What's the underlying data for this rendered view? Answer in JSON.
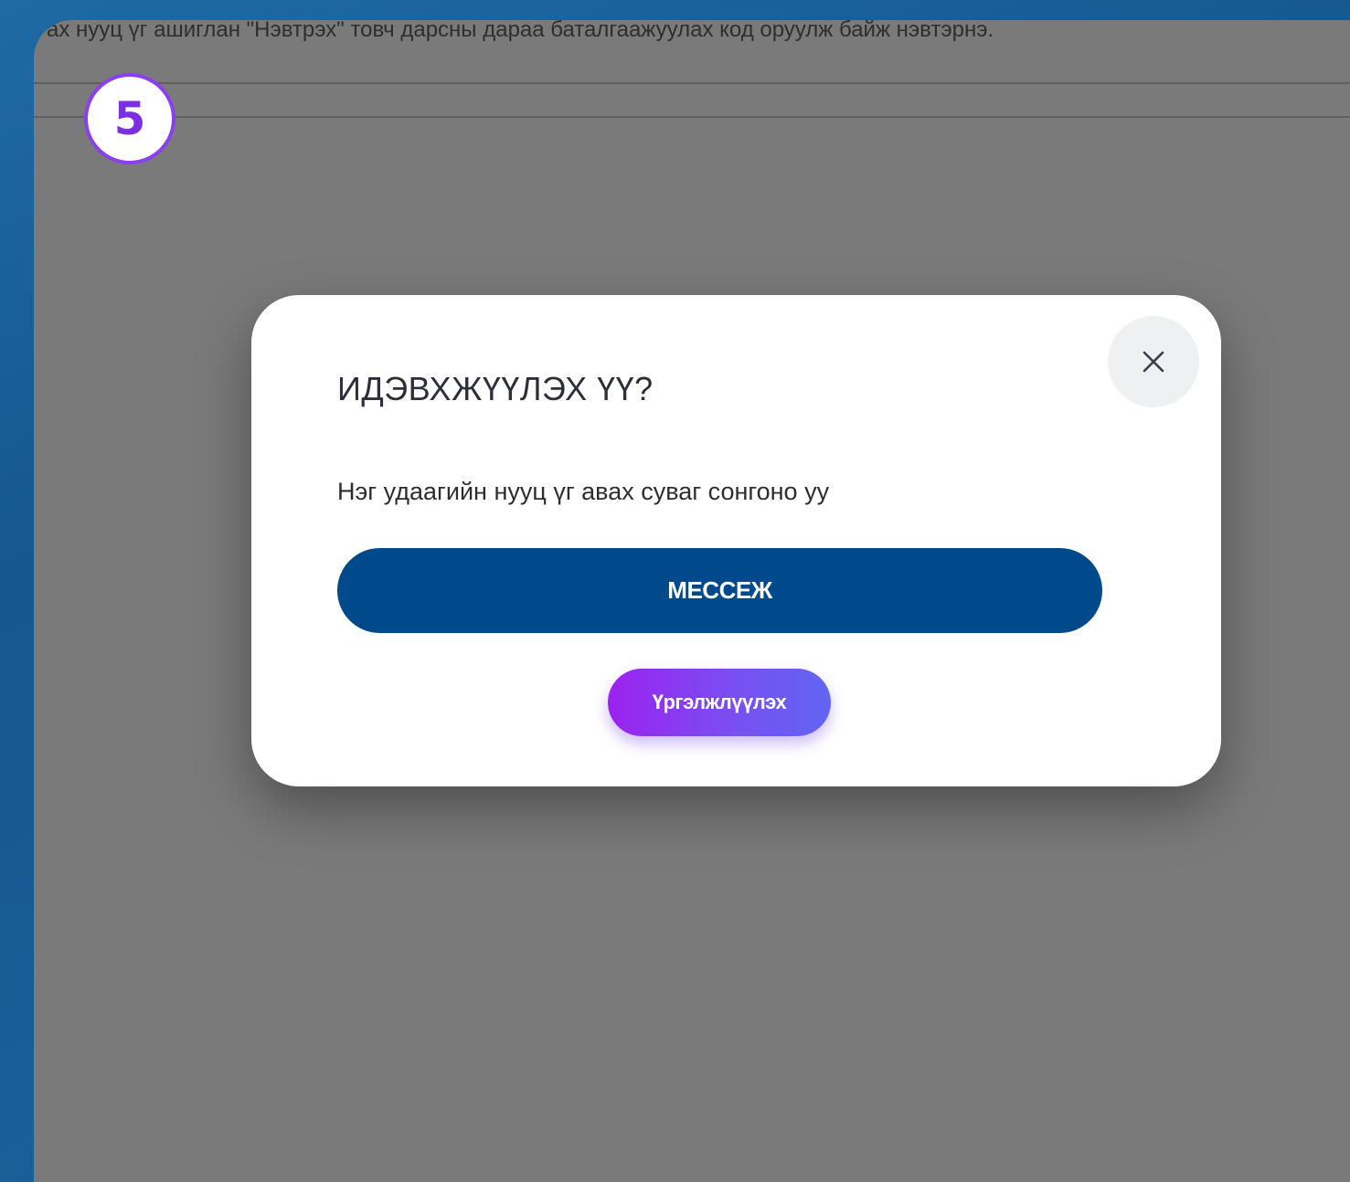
{
  "background_text": "ах нууц үг ашиглан \"Нэвтрэх\" товч дарсны дараа баталгаажуулах код оруулж байж нэвтэрнэ.",
  "step_number": "5",
  "modal": {
    "title": "ИДЭВХЖҮҮЛЭХ ҮҮ?",
    "description": "Нэг удаагийн нууц үг авах суваг сонгоно уу",
    "primary_button": "МЕССЕЖ",
    "secondary_button": "Үргэлжлүүлэх",
    "close_icon": "close-icon"
  },
  "colors": {
    "primary_button": "#004a8c",
    "secondary_gradient_start": "#9b22ef",
    "secondary_gradient_end": "#6165f2",
    "badge_border": "#8a3ff0",
    "overlay": "#7a7a7a"
  }
}
